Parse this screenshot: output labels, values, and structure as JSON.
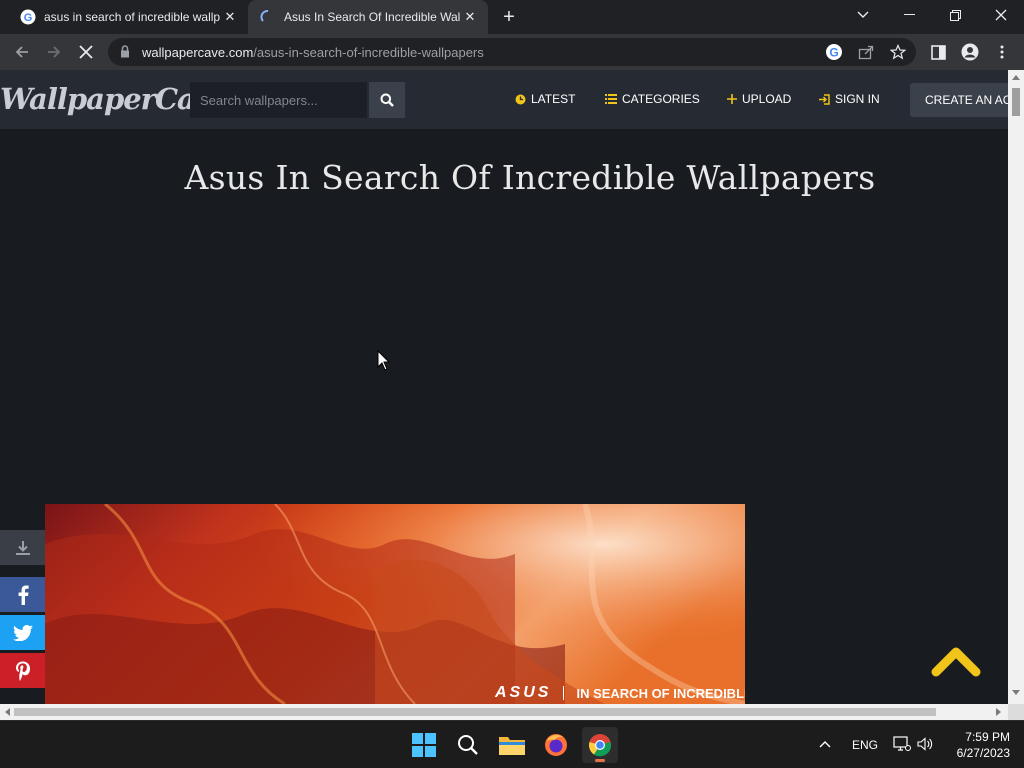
{
  "browser": {
    "tabs": [
      {
        "title": "asus in search of incredible wallp",
        "active": false
      },
      {
        "title": "Asus In Search Of Incredible Wall",
        "active": true
      }
    ],
    "url": {
      "host": "wallpapercave.com",
      "path": "/asus-in-search-of-incredible-wallpapers"
    }
  },
  "site": {
    "logo": "WallpaperCave",
    "search": {
      "placeholder": "Search wallpapers..."
    },
    "nav": {
      "latest": "LATEST",
      "categories": "CATEGORIES",
      "upload": "UPLOAD",
      "sign_in": "SIGN IN",
      "create_account": "CREATE AN AC"
    },
    "page_title": "Asus In Search Of Incredible Wallpapers",
    "wallpaper": {
      "brand": "ASUS",
      "caption": "IN SEARCH OF INCREDIBLE"
    },
    "colors": {
      "accent": "#f0c419",
      "header": "#262b33",
      "background": "#181b20"
    }
  },
  "taskbar": {
    "language": "ENG",
    "time": "7:59 PM",
    "date": "6/27/2023"
  }
}
